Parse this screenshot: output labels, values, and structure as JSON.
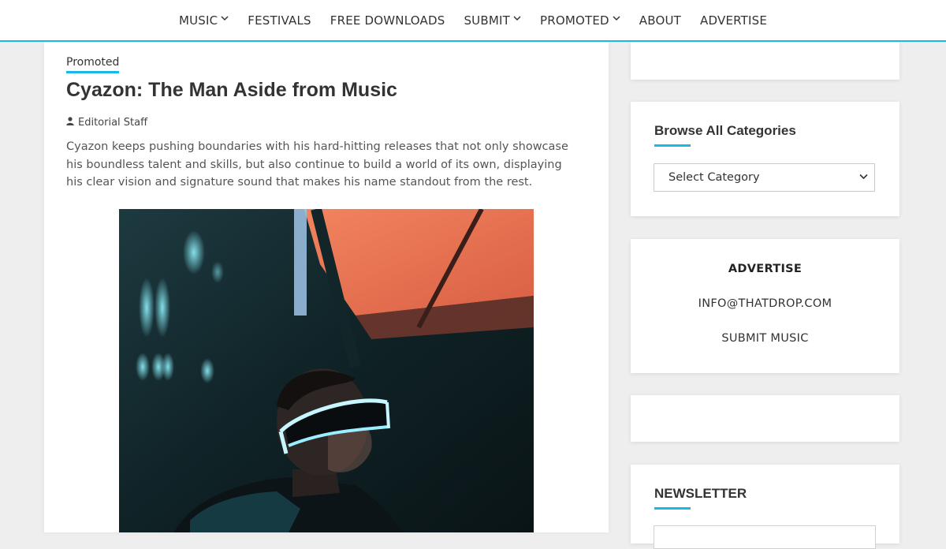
{
  "nav": {
    "items": [
      {
        "label": "MUSIC",
        "has_dropdown": true,
        "icon": "chevron-down-icon"
      },
      {
        "label": "FESTIVALS",
        "has_dropdown": false
      },
      {
        "label": "FREE DOWNLOADS",
        "has_dropdown": false
      },
      {
        "label": "SUBMIT",
        "has_dropdown": true,
        "icon": "chevron-down-icon"
      },
      {
        "label": "PROMOTED",
        "has_dropdown": true,
        "icon": "chevron-down-icon"
      },
      {
        "label": "ABOUT",
        "has_dropdown": false
      },
      {
        "label": "ADVERTISE",
        "has_dropdown": false
      }
    ]
  },
  "article": {
    "category": "Promoted",
    "title": "Cyazon: The Man Aside from Music",
    "author": "Editorial Staff",
    "author_icon": "user-icon",
    "excerpt": "Cyazon keeps pushing boundaries with his hard-hitting releases that not only showcase his boundless talent and skills, but also continue to build a world of its own, displaying his clear vision and signature sound that makes his name standout from the rest."
  },
  "sidebar": {
    "categories": {
      "title": "Browse All Categories",
      "select_value": "Select Category"
    },
    "advertise": {
      "heading": "ADVERTISE",
      "email": "INFO@THATDROP.COM",
      "submit": "SUBMIT MUSIC"
    },
    "newsletter": {
      "title": "NEWSLETTER"
    }
  },
  "colors": {
    "accent": "#1ab8e6",
    "background": "#eeeeee",
    "card": "#ffffff"
  }
}
